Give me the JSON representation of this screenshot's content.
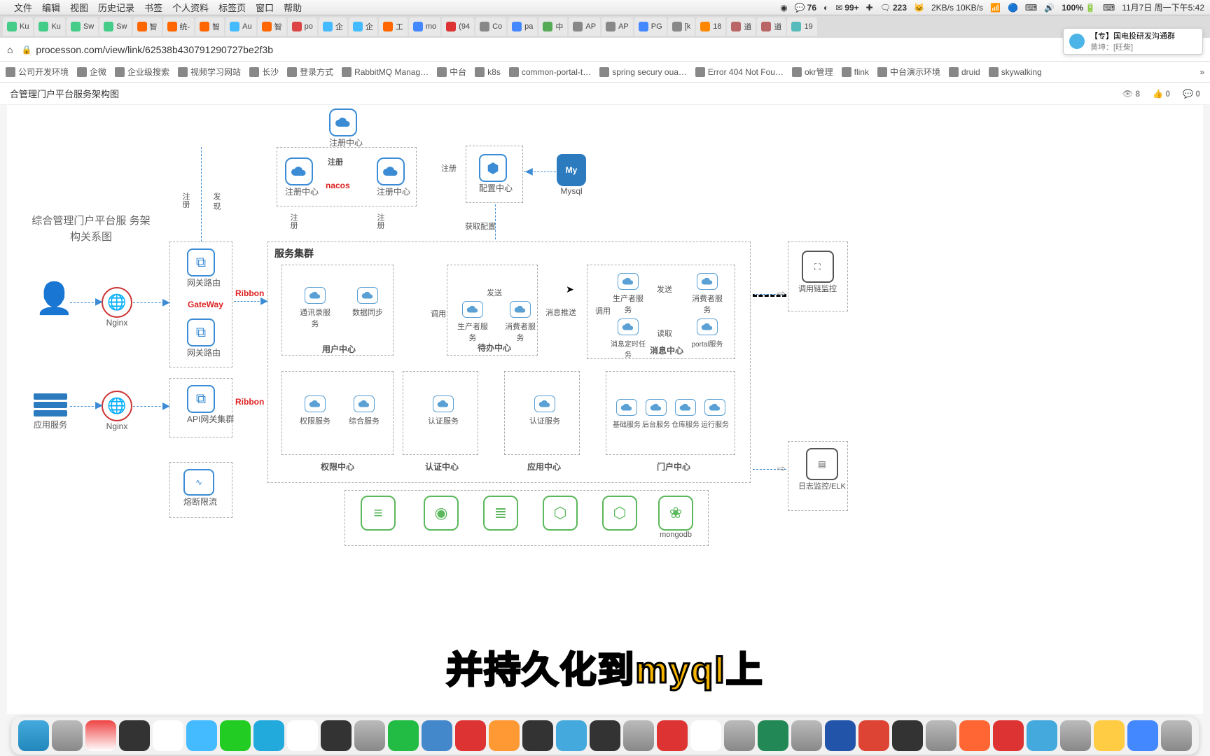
{
  "menubar": {
    "items": [
      "文件",
      "编辑",
      "视图",
      "历史记录",
      "书签",
      "个人资料",
      "标签页",
      "窗口",
      "帮助"
    ],
    "right": {
      "wx": "76",
      "msg": "99+",
      "talk": "223",
      "net": "2KB/s 10KB/s",
      "cpu": "📊",
      "battery": "100%",
      "date": "11月7日 周一下午5:42"
    }
  },
  "tabs": [
    {
      "fav": "#4c8",
      "t": "Ku"
    },
    {
      "fav": "#4c8",
      "t": "Ku"
    },
    {
      "fav": "#4c8",
      "t": "Sw"
    },
    {
      "fav": "#4c8",
      "t": "Sw"
    },
    {
      "fav": "#f60",
      "t": "智"
    },
    {
      "fav": "#f60",
      "t": "统-"
    },
    {
      "fav": "#f60",
      "t": "智"
    },
    {
      "fav": "#4bf",
      "t": "Au"
    },
    {
      "fav": "#f60",
      "t": "智"
    },
    {
      "fav": "#d44",
      "t": "po"
    },
    {
      "fav": "#4bf",
      "t": "企"
    },
    {
      "fav": "#4bf",
      "t": "企"
    },
    {
      "fav": "#f60",
      "t": "工"
    },
    {
      "fav": "#48f",
      "t": "mo"
    },
    {
      "fav": "#d33",
      "t": "(94"
    },
    {
      "fav": "#888",
      "t": "Co"
    },
    {
      "fav": "#48f",
      "t": "pa"
    },
    {
      "fav": "#5a5",
      "t": "中"
    },
    {
      "fav": "#888",
      "t": "AP"
    },
    {
      "fav": "#888",
      "t": "AP"
    },
    {
      "fav": "#48f",
      "t": "PG"
    },
    {
      "fav": "#888",
      "t": "[k"
    },
    {
      "fav": "#f80",
      "t": "18"
    },
    {
      "fav": "#b66",
      "t": "道"
    },
    {
      "fav": "#b66",
      "t": "道"
    },
    {
      "fav": "#5bb",
      "t": "19"
    }
  ],
  "popup": {
    "title": "【专】国电投研发沟通群",
    "sub": "黄坤：[旺柴]"
  },
  "url": "processon.com/view/link/62538b430791290727be2f3b",
  "bookmarks": [
    "公司开发环境",
    "企微",
    "企业级搜索",
    "视频学习网站",
    "长沙",
    "登录方式",
    "RabbitMQ Manag…",
    "中台",
    "k8s",
    "common-portal-t…",
    "spring secury oua…",
    "Error 404 Not Fou…",
    "okr管理",
    "flink",
    "中台演示环境",
    "druid",
    "skywalking"
  ],
  "page": {
    "title": "合管理门户平台服务架构图",
    "views": "8",
    "likes": "0",
    "comments": "0"
  },
  "diagram": {
    "headline": "综合管理门户平台服 务架构关系图",
    "regTop": "注册中心",
    "nacos": "nacos",
    "regL": "注册中心",
    "regR": "注册中心",
    "reg": "注册",
    "discover": "发 现",
    "cfg": "配置中心",
    "mysql": "Mysql",
    "getCfg": "获取配置",
    "svcCluster": "服务集群",
    "gwRoute": "网关路由",
    "ribbon": "Ribbon",
    "gateway": "GateWay",
    "apiGw": "API网关集群",
    "nginx": "Nginx",
    "appSvc": "应用服务",
    "userCenter": "用户中心",
    "addrBook": "通讯录服务",
    "dataSync": "数据同步",
    "call": "调用",
    "todoCenter": "待办中心",
    "producer": "生产者服务",
    "consumer": "消费者服务",
    "msgPush": "消息推送",
    "send": "发送",
    "read": "读取",
    "msgCenter": "消息中心",
    "msgTask": "消息定时任务",
    "portalSvc": "portal服务",
    "permCenter": "权限中心",
    "permSvc": "权限服务",
    "compSvc": "综合服务",
    "authCenter": "认证中心",
    "authSvc": "认证服务",
    "appCenter": "应用中心",
    "appAuthSvc": "认证服务",
    "portalCenter": "门户中心",
    "baseSvc": "基础服务",
    "backSvc": "后台服务",
    "repoSvc": "仓库服务",
    "runSvc": "运行服务",
    "chain": "调用链监控",
    "elk": "日志监控/ELK",
    "fuse": "熔断限流",
    "mongo": "mongodb"
  },
  "subtitle": "并持久化到myql上"
}
